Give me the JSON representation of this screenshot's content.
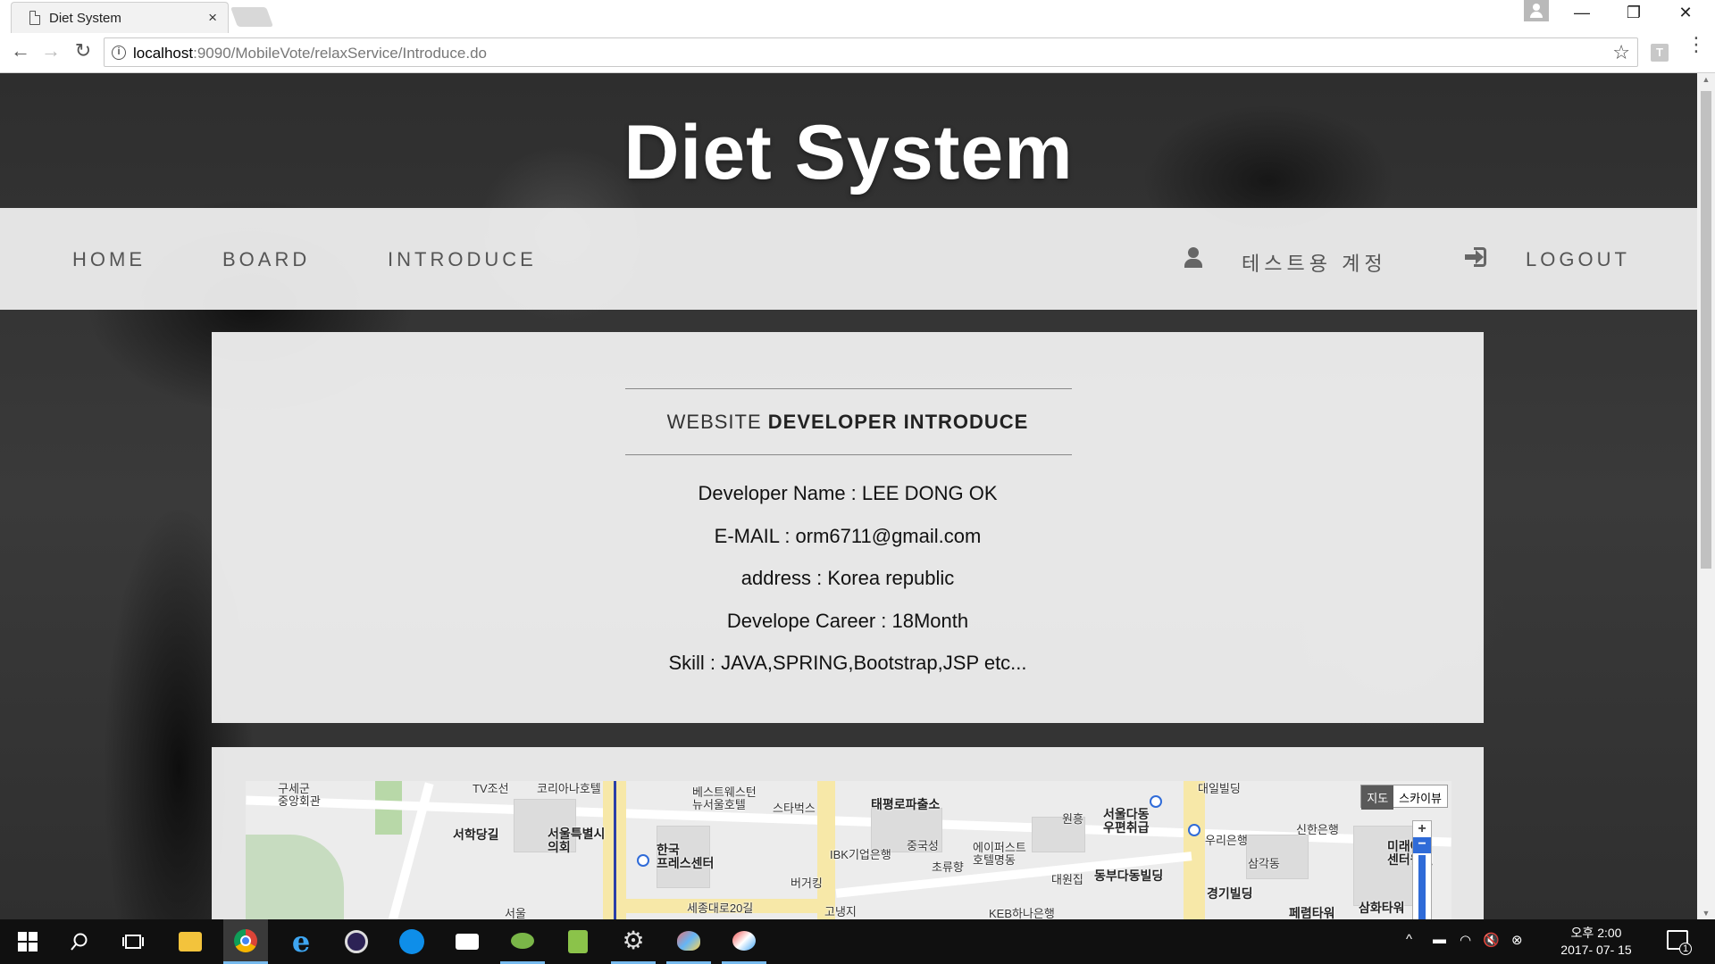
{
  "browser": {
    "tab_title": "Diet System",
    "tab_close": "×",
    "url_host": "localhost",
    "url_rest": ":9090/MobileVote/relaxService/Introduce.do",
    "extension_letter": "T",
    "window_buttons": {
      "minimize": "—",
      "restore": "❐",
      "close": "✕"
    },
    "nav": {
      "back": "←",
      "forward": "→",
      "reload": "↻"
    },
    "star": "☆",
    "menu": "⋮"
  },
  "site": {
    "title": "Diet System",
    "nav": {
      "home": "HOME",
      "board": "BOARD",
      "introduce": "INTRODUCE",
      "user_name": "테스트용 계정",
      "logout": "LOGOUT"
    }
  },
  "intro": {
    "title_prefix": "WEBSITE",
    "title_bold": "DEVELOPER INTRODUCE",
    "lines": [
      "Developer Name : LEE DONG OK",
      "E-MAIL : orm6711@gmail.com",
      "address : Korea republic",
      "Develope Career : 18Month",
      "Skill : JAVA,SPRING,Bootstrap,JSP etc..."
    ]
  },
  "map": {
    "toggle_map": "지도",
    "toggle_sky": "스카이뷰",
    "zoom_in": "+",
    "zoom_out": "−",
    "labels": [
      "구세군\n중앙회관",
      "TV조선",
      "코리아나호텔",
      "서학당길",
      "서울특별시\n의회",
      "베스트웨스턴\n뉴서울호텔",
      "스타벅스",
      "한국\n프레스센터",
      "IBK기업은행",
      "버거킹",
      "세종대로20길",
      "고냉지",
      "태평로파출소",
      "중국성",
      "초류향",
      "에이퍼스트\n호텔명동",
      "대원집",
      "원흥",
      "서울다동\n우편취급",
      "동부다동빌딩",
      "대일빌딩",
      "우리은행",
      "경기빌딩",
      "신한은행",
      "삼각동",
      "미래에\n센터원빌",
      "삼화타워",
      "페렴타워",
      "KEB하나은행",
      "서울"
    ]
  },
  "taskbar": {
    "clock_time": "오후 2:00",
    "clock_date": "2017- 07- 15",
    "notification_count": "1"
  },
  "colors": {
    "navbar_bg": "#f2f2f2",
    "card_bg": "#f0f0f0",
    "title_text": "#ffffff",
    "taskbar": "#101010",
    "accent_blue": "#2f6bd8"
  }
}
